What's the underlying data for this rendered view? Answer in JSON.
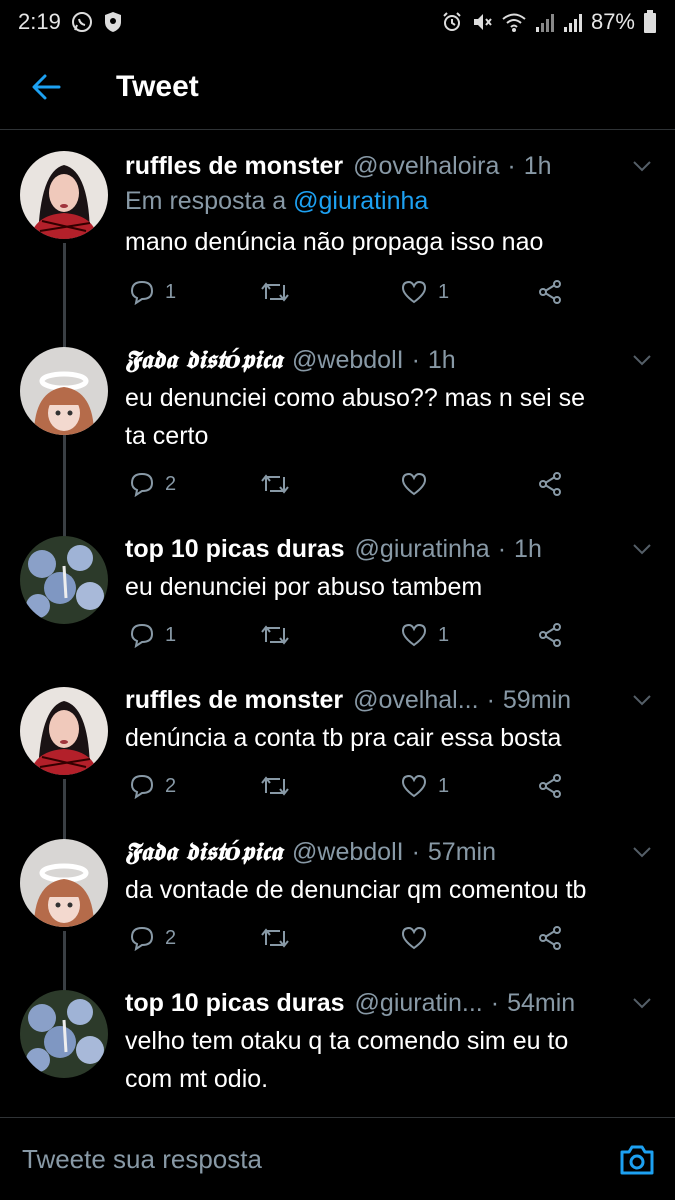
{
  "status_bar": {
    "time": "2:19",
    "battery": "87%"
  },
  "header": {
    "title": "Tweet"
  },
  "tweets": [
    {
      "name": "ruffles de monster",
      "handle": "@ovelhaloira",
      "sep": "·",
      "time": "1h",
      "reply_prefix": "Em resposta a",
      "reply_to": "@giuratinha",
      "lines": [
        "mano denúncia não propaga isso nao"
      ],
      "replies": "1",
      "retweets": "",
      "likes": "1",
      "avatar": "woman-red-plaid"
    },
    {
      "name": "𝕱𝖆𝖉𝖆 𝖉𝖎𝖘𝖙ó𝖕𝖎𝖈𝖆",
      "handle": "@webdolI",
      "sep": "·",
      "time": "1h",
      "lines": [
        "eu denunciei como abuso?? mas n sei se",
        "ta certo"
      ],
      "replies": "2",
      "retweets": "",
      "likes": "",
      "avatar": "girl-halo"
    },
    {
      "name": "top 10 picas duras",
      "handle": "@giuratinha",
      "sep": "·",
      "time": "1h",
      "lines": [
        "eu denunciei por abuso tambem"
      ],
      "replies": "1",
      "retweets": "",
      "likes": "1",
      "avatar": "hydrangea-flowers"
    },
    {
      "name": "ruffles de monster",
      "handle": "@ovelhal...",
      "sep": "·",
      "time": "59min",
      "lines": [
        "denúncia a conta tb pra cair essa bosta"
      ],
      "replies": "2",
      "retweets": "",
      "likes": "1",
      "avatar": "woman-red-plaid"
    },
    {
      "name": "𝕱𝖆𝖉𝖆 𝖉𝖎𝖘𝖙ó𝖕𝖎𝖈𝖆",
      "handle": "@webdolI",
      "sep": "·",
      "time": "57min",
      "lines": [
        "da vontade de denunciar qm comentou tb"
      ],
      "replies": "2",
      "retweets": "",
      "likes": "",
      "avatar": "girl-halo"
    },
    {
      "name": "top 10 picas duras",
      "handle": "@giuratin...",
      "sep": "·",
      "time": "54min",
      "lines": [
        "velho tem otaku q ta comendo sim eu to",
        "com mt odio."
      ],
      "replies": "",
      "retweets": "",
      "likes": "",
      "avatar": "hydrangea-flowers"
    }
  ],
  "composer": {
    "placeholder": "Tweete sua resposta"
  },
  "colors": {
    "background": "#000000",
    "accent": "#1da1f2",
    "muted": "#8899a6",
    "divider": "#2f3336"
  }
}
